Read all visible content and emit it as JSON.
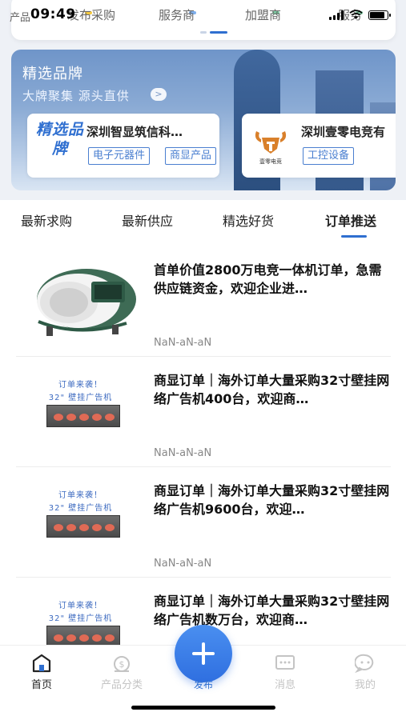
{
  "status_bar": {
    "time": "09:49",
    "battery_level": 0.85
  },
  "categories": {
    "items": [
      {
        "label": "产品"
      },
      {
        "label": "发布采购"
      },
      {
        "label": "服务商"
      },
      {
        "label": "加盟商"
      },
      {
        "label": "服务"
      }
    ]
  },
  "banner": {
    "title": "精选品牌",
    "subtitle": "大牌聚集 源头直供",
    "brands": [
      {
        "logo_text": "精选品牌",
        "name": "深圳智显筑信科…",
        "tags": [
          "电子元器件",
          "商显产品"
        ]
      },
      {
        "logo_text": "壹零电竞",
        "name": "深圳壹零电竞有",
        "tags": [
          "工控设备"
        ]
      }
    ]
  },
  "tabs": [
    {
      "label": "最新求购",
      "active": false
    },
    {
      "label": "最新供应",
      "active": false
    },
    {
      "label": "精选好货",
      "active": false
    },
    {
      "label": "订单推送",
      "active": true
    }
  ],
  "orders": [
    {
      "title": "首单价值2800万电竞一体机订单，急需供应链资金，欢迎企业进…",
      "date": "NaN-aN-aN",
      "image": "gaming-pod"
    },
    {
      "title": "商显订单｜海外订单大量采购32寸壁挂网络广告机400台，欢迎商…",
      "date": "NaN-aN-aN",
      "image": "order-promo"
    },
    {
      "title": "商显订单｜海外订单大量采购32寸壁挂网络广告机9600台，欢迎…",
      "date": "NaN-aN-aN",
      "image": "order-promo"
    },
    {
      "title": "商显订单｜海外订单大量采购32寸壁挂网络广告机数万台，欢迎商…",
      "date": "",
      "image": "order-promo"
    }
  ],
  "promo_image": {
    "line1": "订单来袭！",
    "line2": "32\" 壁挂广告机"
  },
  "bottom_nav": {
    "items": [
      {
        "label": "首页",
        "icon": "home-icon",
        "active": true
      },
      {
        "label": "产品分类",
        "icon": "money-bag-icon",
        "active": false
      },
      {
        "label": "消息",
        "icon": "message-icon",
        "active": false
      },
      {
        "label": "我的",
        "icon": "profile-icon",
        "active": false
      }
    ],
    "publish_label": "发布"
  },
  "colors": {
    "accent": "#2f6fd0",
    "inactive": "#c4c4c4",
    "tag": "#4a7fd0"
  }
}
